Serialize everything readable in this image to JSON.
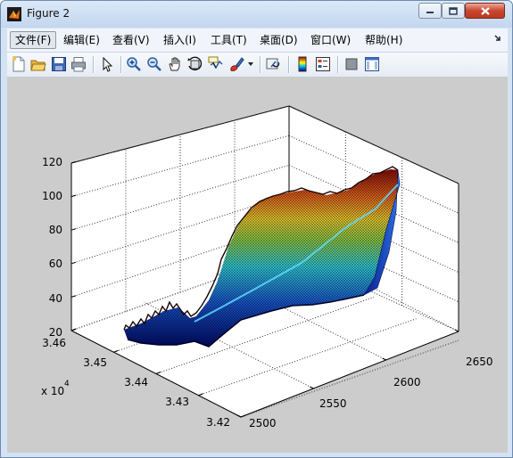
{
  "window": {
    "title": "Figure 2",
    "controls": {
      "minimize": "minimize",
      "maximize": "maximize",
      "close": "close"
    }
  },
  "menu": {
    "items": [
      {
        "label": "文件(F)",
        "active": true
      },
      {
        "label": "编辑(E)"
      },
      {
        "label": "查看(V)"
      },
      {
        "label": "插入(I)"
      },
      {
        "label": "工具(T)"
      },
      {
        "label": "桌面(D)"
      },
      {
        "label": "窗口(W)"
      },
      {
        "label": "帮助(H)"
      }
    ]
  },
  "toolbar": {
    "buttons": [
      "new-figure-icon",
      "open-file-icon",
      "save-icon",
      "print-icon",
      "edit-plot-arrow-icon",
      "zoom-in-icon",
      "zoom-out-icon",
      "pan-hand-icon",
      "rotate-3d-icon",
      "data-cursor-icon",
      "brush-icon",
      "brush-dropdown-icon",
      "link-plot-icon",
      "colorbar-icon",
      "legend-icon",
      "hide-plot-tools-icon",
      "show-plot-tools-icon"
    ]
  },
  "chart_data": {
    "type": "surface",
    "title": "",
    "colormap": "jet",
    "grid": true,
    "z_axis": {
      "ticks": [
        "20",
        "40",
        "60",
        "80",
        "100",
        "120"
      ],
      "range": [
        20,
        120
      ]
    },
    "y_axis": {
      "ticks": [
        "3.42",
        "3.43",
        "3.44",
        "3.45",
        "3.46"
      ],
      "multiplier_label": "x 10",
      "multiplier_exponent": "4",
      "range": [
        34200,
        34600
      ]
    },
    "x_axis": {
      "ticks": [
        "2500",
        "2550",
        "2600",
        "2650"
      ],
      "range": [
        2500,
        2650
      ]
    },
    "surface_description_values": {
      "z_min_approx": 20,
      "z_max_approx": 110
    }
  }
}
